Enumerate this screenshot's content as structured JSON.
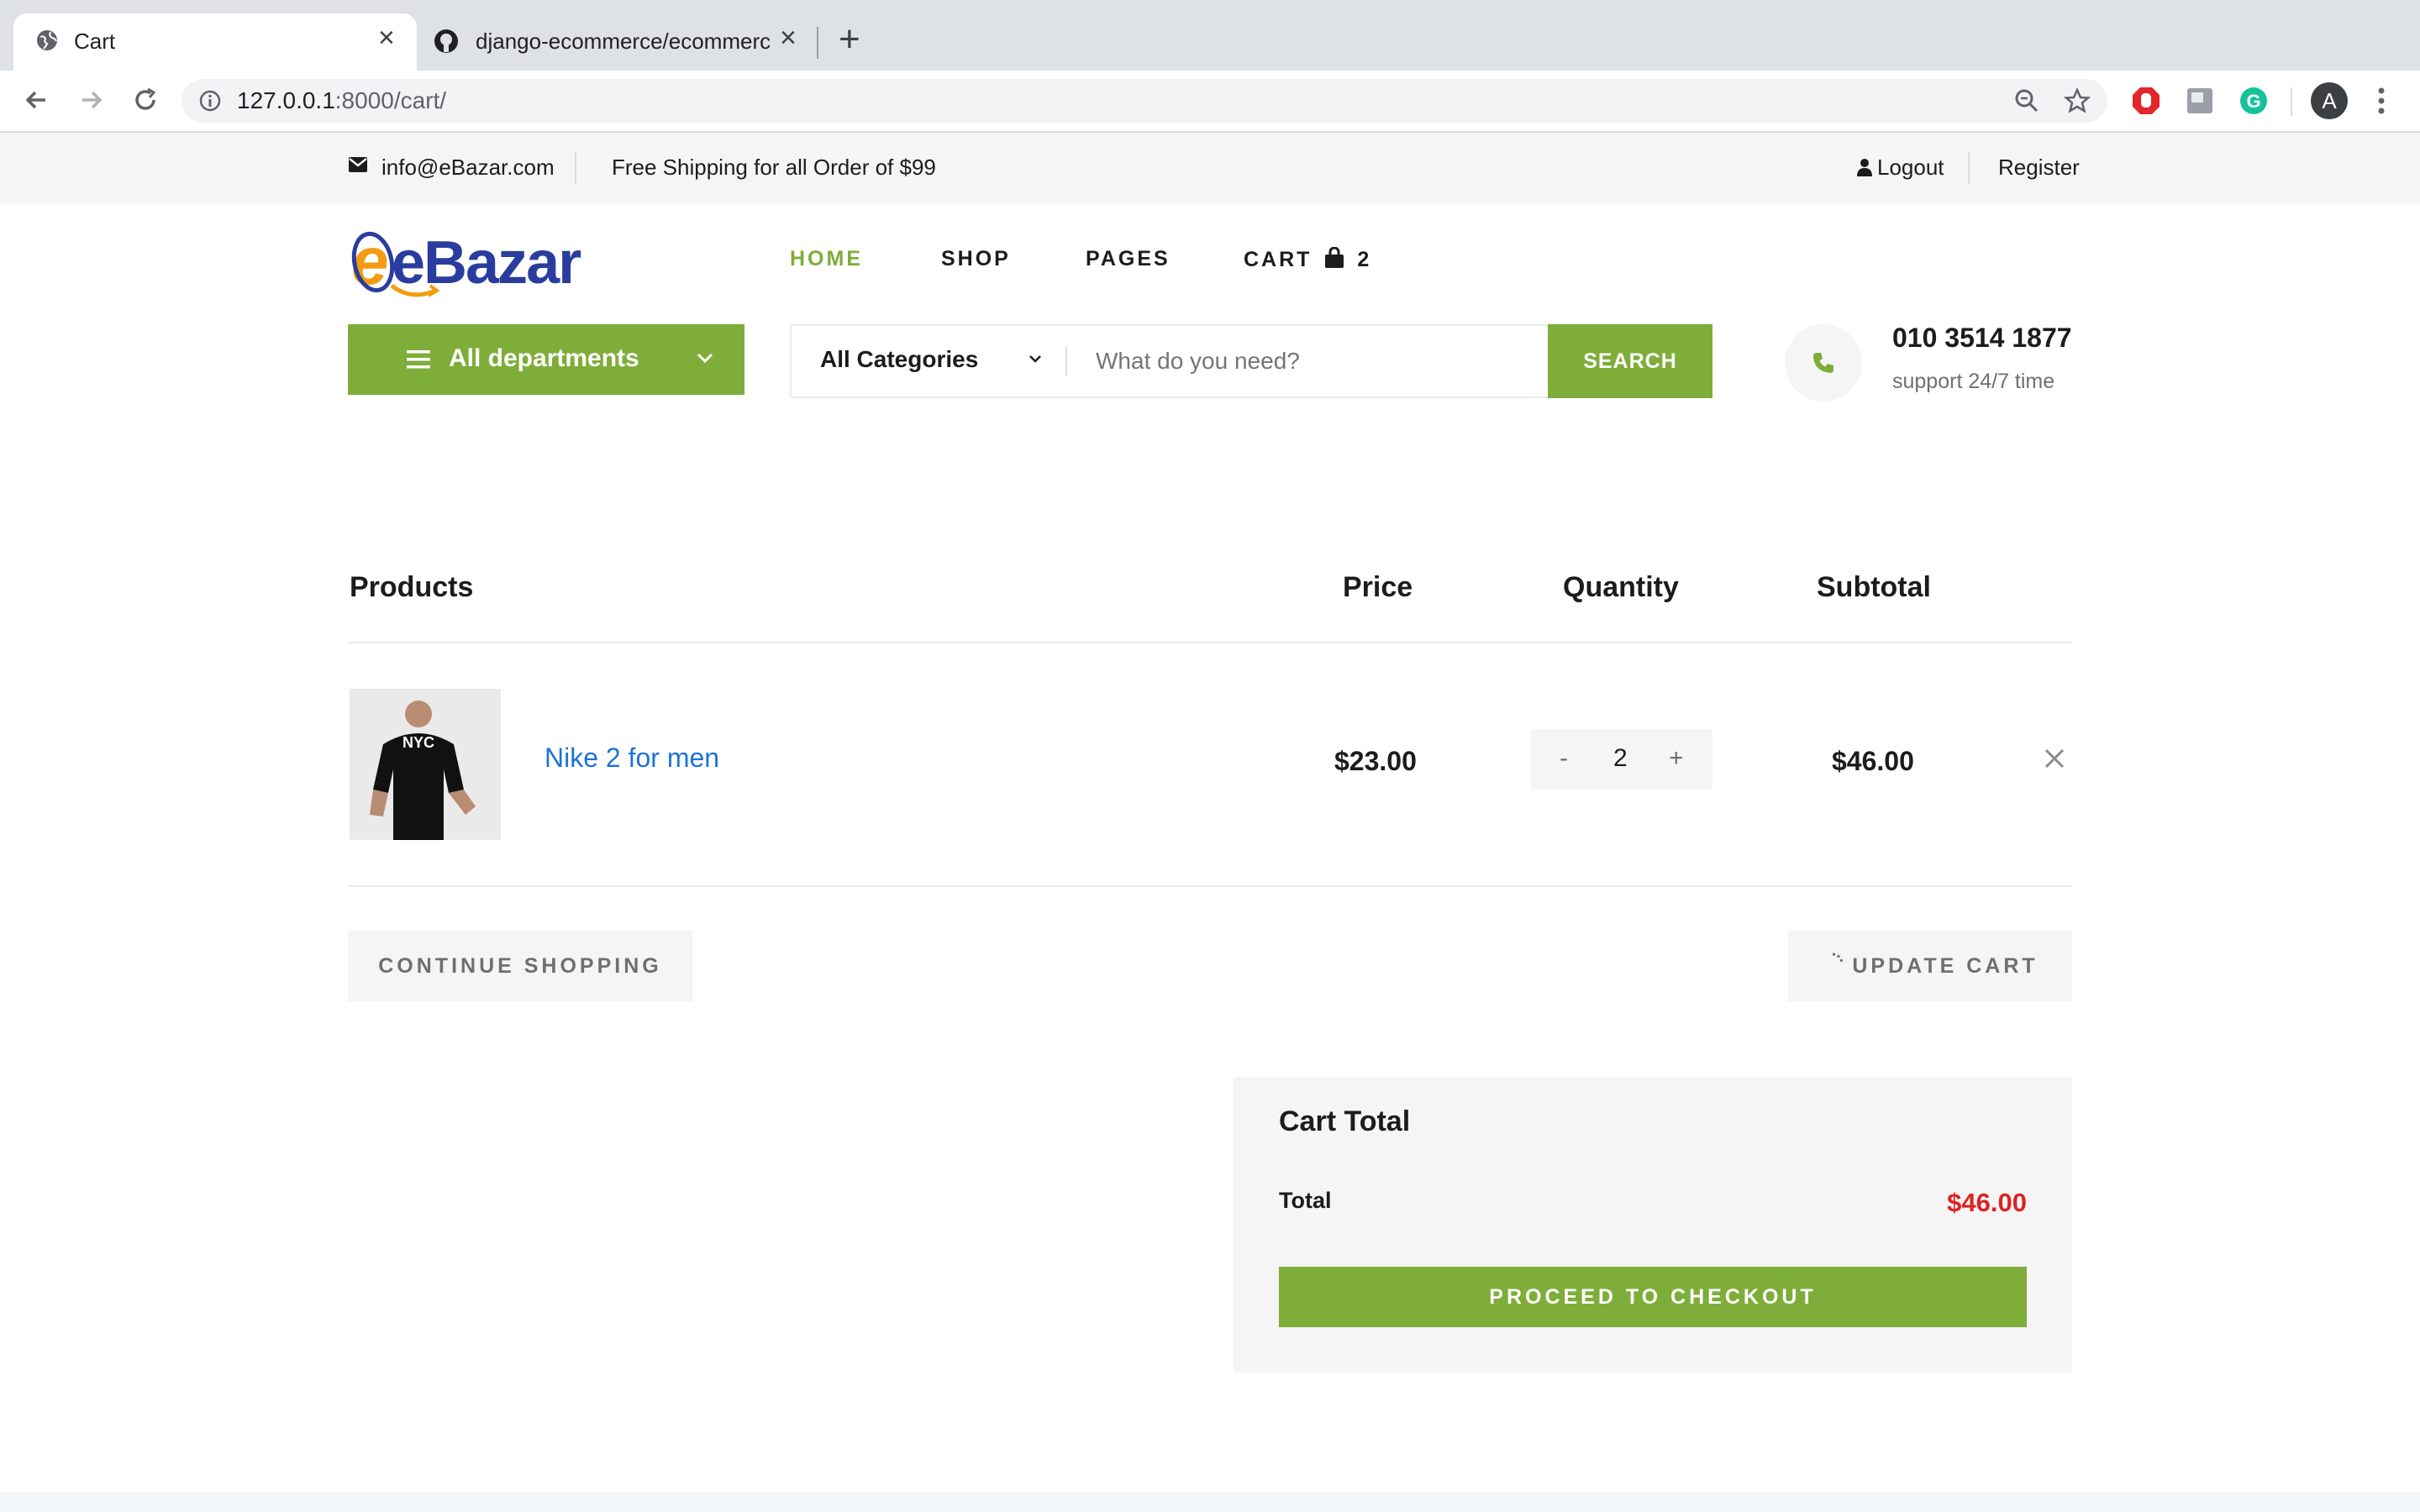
{
  "browser": {
    "tabs": [
      {
        "title": "Cart"
      },
      {
        "title": "django-ecommerce/ecommerce"
      }
    ],
    "url_host": "127.0.0.1",
    "url_rest": ":8000/cart/",
    "profile_initial": "A"
  },
  "topbar": {
    "email": "info@eBazar.com",
    "shipping": "Free Shipping for all Order of $99",
    "logout": "Logout",
    "register": "Register"
  },
  "logo": {
    "text": "eBazar"
  },
  "nav": {
    "home": "HOME",
    "shop": "SHOP",
    "pages": "PAGES",
    "cart": "CART",
    "cart_count": "2"
  },
  "departments": {
    "label": "All departments"
  },
  "search": {
    "category": "All Categories",
    "placeholder": "What do you need?",
    "button": "SEARCH"
  },
  "contact": {
    "phone": "010 3514 1877",
    "support": "support 24/7 time"
  },
  "table": {
    "headers": [
      "Products",
      "Price",
      "Quantity",
      "Subtotal"
    ],
    "rows": [
      {
        "name": "Nike 2 for men",
        "price": "$23.00",
        "quantity": "2",
        "subtotal": "$46.00"
      }
    ]
  },
  "buttons": {
    "continue": "CONTINUE SHOPPING",
    "update": "UPDATE CART",
    "minus": "-",
    "plus": "+"
  },
  "cart_total": {
    "title": "Cart Total",
    "total_label": "Total",
    "total_value": "$46.00",
    "checkout": "PROCEED TO CHECKOUT"
  },
  "colors": {
    "accent": "#7fad39",
    "price_red": "#dd2222",
    "link_blue": "#1e73d6"
  }
}
